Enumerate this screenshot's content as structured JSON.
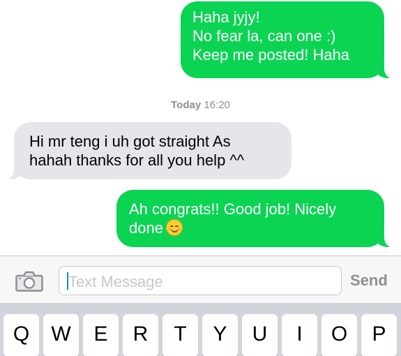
{
  "messages": [
    {
      "direction": "outgoing",
      "lines": [
        "Haha jyjy!",
        "No fear la, can one :)",
        "Keep me posted! Haha"
      ]
    },
    {
      "direction": "incoming",
      "lines": [
        "Hi mr teng i uh got straight As",
        "hahah thanks for all you help ^^"
      ]
    },
    {
      "direction": "outgoing",
      "lines": [
        "Ah congrats!! Good job! Nicely",
        "done"
      ],
      "emoji": "smiling-face-emoji"
    }
  ],
  "timestamp": {
    "day": "Today",
    "time": "16:20"
  },
  "composer": {
    "camera_icon": "camera-icon",
    "placeholder": "Text Message",
    "send_label": "Send"
  },
  "keyboard": {
    "row1": [
      "Q",
      "W",
      "E",
      "R",
      "T",
      "Y",
      "U",
      "I",
      "O",
      "P"
    ]
  },
  "colors": {
    "outgoing_bubble": "#0bd453",
    "incoming_bubble": "#e5e5ea",
    "caret": "#1f7cf5"
  }
}
